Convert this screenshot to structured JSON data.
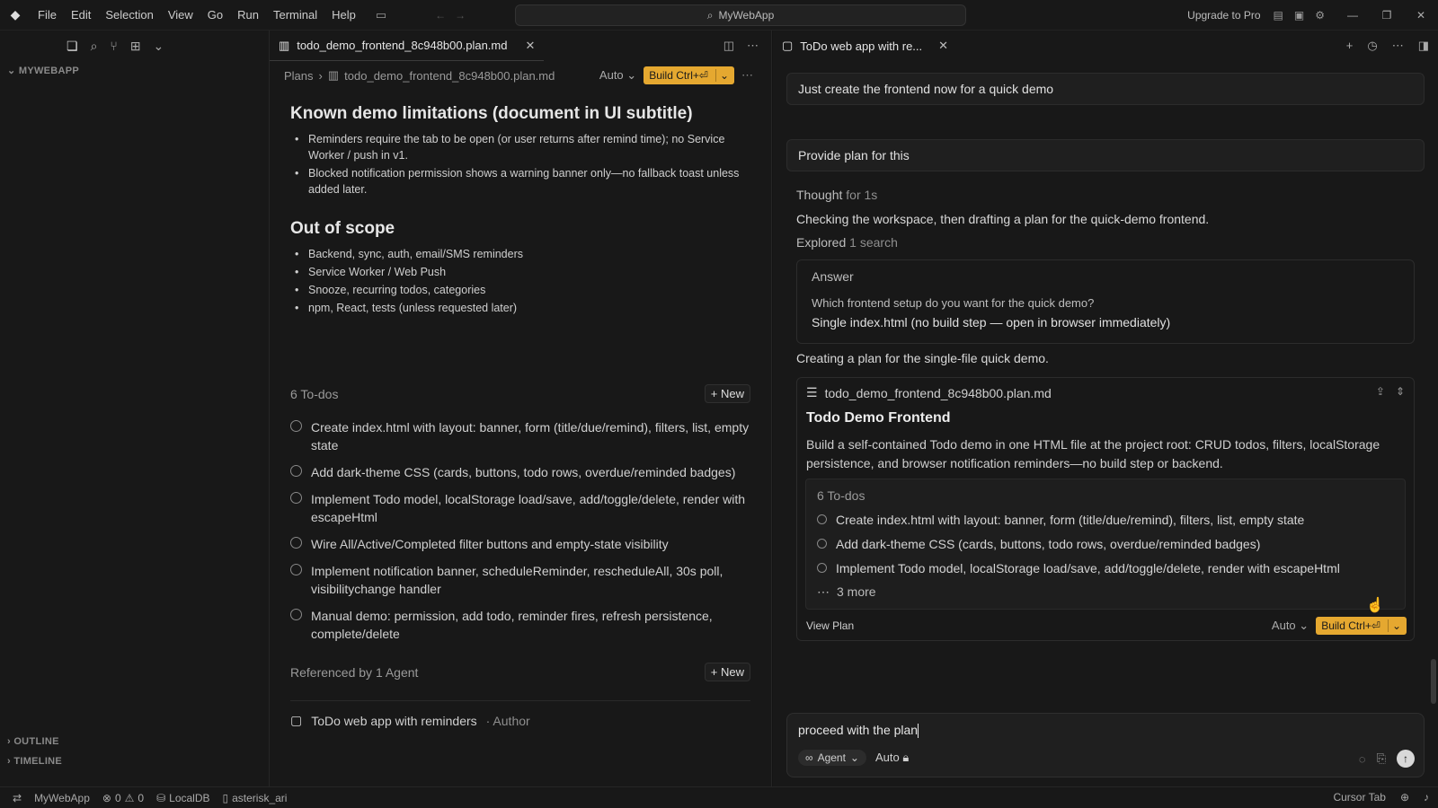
{
  "titlebar": {
    "menu": [
      "File",
      "Edit",
      "Selection",
      "View",
      "Go",
      "Run",
      "Terminal",
      "Help"
    ],
    "search": "MyWebApp",
    "upgrade": "Upgrade to Pro"
  },
  "sidebar": {
    "title": "MYWEBAPP",
    "outline": "OUTLINE",
    "timeline": "TIMELINE"
  },
  "editor": {
    "tab_label": "todo_demo_frontend_8c948b00.plan.md",
    "breadcrumb_root": "Plans",
    "breadcrumb_file": "todo_demo_frontend_8c948b00.plan.md",
    "auto_label": "Auto",
    "build_label": "Build Ctrl+⏎",
    "sections": [
      {
        "heading": "Known demo limitations (document in UI subtitle)",
        "items": [
          "Reminders require the tab to be open (or user returns after remind time); no Service Worker / push in v1.",
          "Blocked notification permission shows a warning banner only—no fallback toast unless added later."
        ]
      },
      {
        "heading": "Out of scope",
        "items": [
          "Backend, sync, auth, email/SMS reminders",
          "Service Worker / Web Push",
          "Snooze, recurring todos, categories",
          "npm, React, tests (unless requested later)"
        ]
      }
    ],
    "todos_label": "6 To-dos",
    "new_label": "New",
    "todos": [
      "Create index.html with layout: banner, form (title/due/remind), filters, list, empty state",
      "Add dark-theme CSS (cards, buttons, todo rows, overdue/reminded badges)",
      "Implement Todo model, localStorage load/save, add/toggle/delete, render with escapeHtml",
      "Wire All/Active/Completed filter buttons and empty-state visibility",
      "Implement notification banner, scheduleReminder, rescheduleAll, 30s poll, visibilitychange handler",
      "Manual demo: permission, add todo, reminder fires, refresh persistence, complete/delete"
    ],
    "referenced_label": "Referenced by 1 Agent",
    "ref_item": "ToDo web app with reminders",
    "ref_author": "· Author"
  },
  "chat": {
    "tab_label": "ToDo web app with re...",
    "msg1": "Just create the frontend now for a quick demo",
    "msg2": "Provide plan for this",
    "thought": "Thought",
    "thought_dur": "for 1s",
    "checking": "Checking the workspace, then drafting a plan for the quick-demo frontend.",
    "explored": "Explored",
    "explored_dim": "1 search",
    "answer_title": "Answer",
    "answer_q": "Which frontend setup do you want for the quick demo?",
    "answer_a": "Single index.html (no build step — open in browser immediately)",
    "creating": "Creating a plan for the single-file quick demo.",
    "plan_file": "todo_demo_frontend_8c948b00.plan.md",
    "plan_title": "Todo Demo Frontend",
    "plan_desc": "Build a self-contained Todo demo in one HTML file at the project root: CRUD todos, filters, localStorage persistence, and browser notification reminders—no build step or backend.",
    "plan_todos_label": "6 To-dos",
    "plan_todos": [
      "Create index.html with layout: banner, form (title/due/remind), filters, list, empty state",
      "Add dark-theme CSS (cards, buttons, todo rows, overdue/reminded badges)",
      "Implement Todo model, localStorage load/save, add/toggle/delete, render with escapeHtml"
    ],
    "more": "3 more",
    "view_plan": "View Plan",
    "auto_label": "Auto",
    "build_label": "Build Ctrl+⏎",
    "composer_text": "proceed with the plan",
    "agent_label": "Agent",
    "model_label": "Auto"
  },
  "statusbar": {
    "project": "MyWebApp",
    "errors": "0",
    "warnings": "0",
    "db": "LocalDB",
    "branch": "asterisk_ari",
    "cursor_tab": "Cursor Tab"
  },
  "colors": {
    "accent_build": "#e5a830",
    "background": "#181818"
  }
}
